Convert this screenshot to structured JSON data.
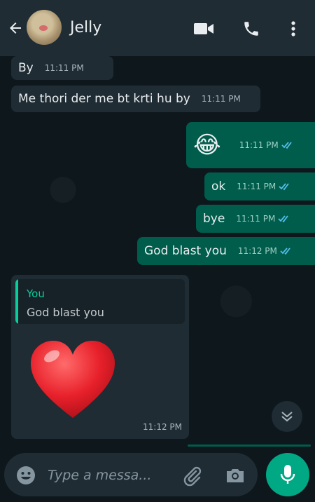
{
  "header": {
    "contact_name": "Jelly",
    "icons": [
      "back-arrow-icon",
      "video-call-icon",
      "phone-call-icon",
      "more-menu-icon"
    ]
  },
  "messages": [
    {
      "direction": "in",
      "text": "By",
      "time": "11:11 PM"
    },
    {
      "direction": "in",
      "text": "Me thori der me bt krti hu by",
      "time": "11:11 PM"
    },
    {
      "direction": "out",
      "text": "😂",
      "time": "11:11 PM"
    },
    {
      "direction": "out",
      "text": "ok",
      "time": "11:11 PM"
    },
    {
      "direction": "out",
      "text": "bye",
      "time": "11:11 PM"
    },
    {
      "direction": "out",
      "text": "God blast you",
      "time": "11:12 PM"
    }
  ],
  "reply_message": {
    "quoted_author": "You",
    "quoted_text": "God blast you",
    "content": "❤️",
    "time": "11:12 PM"
  },
  "composer": {
    "placeholder": "Type a messa..."
  },
  "colors": {
    "header_bg": "#1f2c34",
    "incoming_bubble": "#1f2c34",
    "outgoing_bubble": "#005c4b",
    "accent": "#00a884",
    "read_ticks": "#53bdeb"
  }
}
